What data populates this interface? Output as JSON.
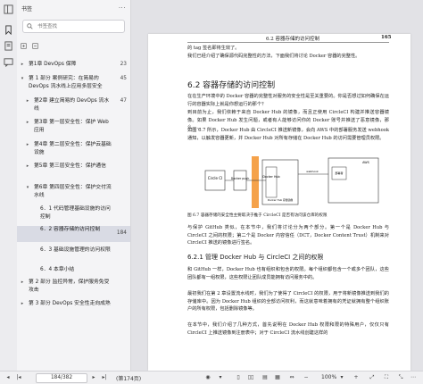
{
  "sidebar": {
    "title": "书签",
    "more": "···",
    "search_placeholder": "书签查找",
    "items": [
      {
        "label": "第1章 DevOps 保障",
        "page": "23",
        "arrow": "▸"
      },
      {
        "label": "第 1 部分 案例研究：在简易的 DevOps 流水线上应用多层安全",
        "page": "45",
        "arrow": "▾"
      },
      {
        "label": "第2章 建立简易的 DevOps 流水线",
        "page": "47",
        "arrow": "▸"
      },
      {
        "label": "第3章 第一层安全性：保护 Web 应用",
        "page": "",
        "arrow": "▸"
      },
      {
        "label": "第4章 第二层安全性：保护云基础设施",
        "page": "",
        "arrow": "▸"
      },
      {
        "label": "第5章 第三层安全性：保护通信",
        "page": "",
        "arrow": "▸"
      },
      {
        "label": "第6章 第四层安全性：保护交付流水线",
        "page": "",
        "arrow": "▾"
      },
      {
        "label": "6．1 代码管理基础设施的访问控制",
        "page": "",
        "arrow": ""
      },
      {
        "label": "6．2 容器存储的访问控制",
        "page": "184",
        "arrow": ""
      },
      {
        "label": "6．3 基础设施管理的访问权限",
        "page": "",
        "arrow": ""
      },
      {
        "label": "6．4 本章小结",
        "page": "",
        "arrow": ""
      },
      {
        "label": "第 2 部分 监控异常，保护服务免受攻击",
        "page": "",
        "arrow": "▸"
      },
      {
        "label": "第 3 部分 DevOps 安全性走向成熟",
        "page": "",
        "arrow": "▸"
      }
    ]
  },
  "page": {
    "running_head": "6.2 容器存储的访问控制",
    "page_number": "165",
    "intro_lines": [
      "的 tag 签名即将生效了。",
      "我们已经介绍了确保源代码完整性的方法，下面我们将讨论 Docker 容器的完整性。"
    ],
    "section_title": "6.2 容器存储的访问控制",
    "section_paras": [
      "在在生产环境中的 Docker 容器的完整性对服务的安全性是至关重要的。你是否想过如何确保在运行的容器实际上就是你想运行的那个？",
      "到目前为止，我们依赖于来自 Docker Hub 的镜像，而且正使用 CircleCI 构建并推送容器镜像。如果 Docker Hub 发生问题，或者有人能够访问你的 Docker 账号并推送了恶意镜像，那么……",
      "如图 6.7 所示，Docker Hub 由 CircleCI 推送新镜像，会向 AWS 中的部署服务发送 webhook 通知，以触发容器更新，并 Docker Hub 对所有存储在 Docker Hub 的访问需要管理员权限。"
    ],
    "diagram": {
      "circleci": "Circle CI",
      "docker_push": "Docker push",
      "docker_hub": "Docker Hub",
      "webhook": "webhook",
      "aws": "AWS",
      "deployer": "部署者",
      "creds": "Docker Hub 存储镜像"
    },
    "figure_caption": "图 6.7 容器存储的安全性主要取决于推于 CircleCI 是否有访问该仓库的权限",
    "after_fig": [
      "与保护 GitHub 类似，在本节中，我们将讨论分为两个部分。第一个是 Docker Hub 与 CircleCI 之间的权限；第二个是 Docker 内容信任（DCT，Docker Content Trust）机制来对 CircleCI 推送的镜像进行签名。"
    ],
    "subsection_title": "6.2.1 管理 Docker Hub 与 CircleCI 之间的权限",
    "sub_paras": [
      "和 GitHub 一样，Docker Hub 也有组织和包含的权限。每个组织都包含一个或多个团队，这些团队都有一组权限，这些权限让团队成员能拥有访问服务中的。",
      "最初我们在第 2 章设置流水线时，我们为了使得了 CircleCI 的权限，用于将新镜像推送到我们的存储库中。因为 Docker Hub 组织的全部访问权利，而这就意味着拥有的凭证就拥有整个组织账户的所有权限，包括删除镜像等。",
      "在本节中，我们介绍了几种方式，首先说明在 Docker Hub 权限和限的特殊用户，仅仅只有 CircleCI 上推送镜像到注册表中；对于 CircleCI 流水线创建这样的"
    ]
  },
  "statusbar": {
    "page_input": "184/382",
    "current_page": "(第174页)",
    "zoom": "100%"
  }
}
